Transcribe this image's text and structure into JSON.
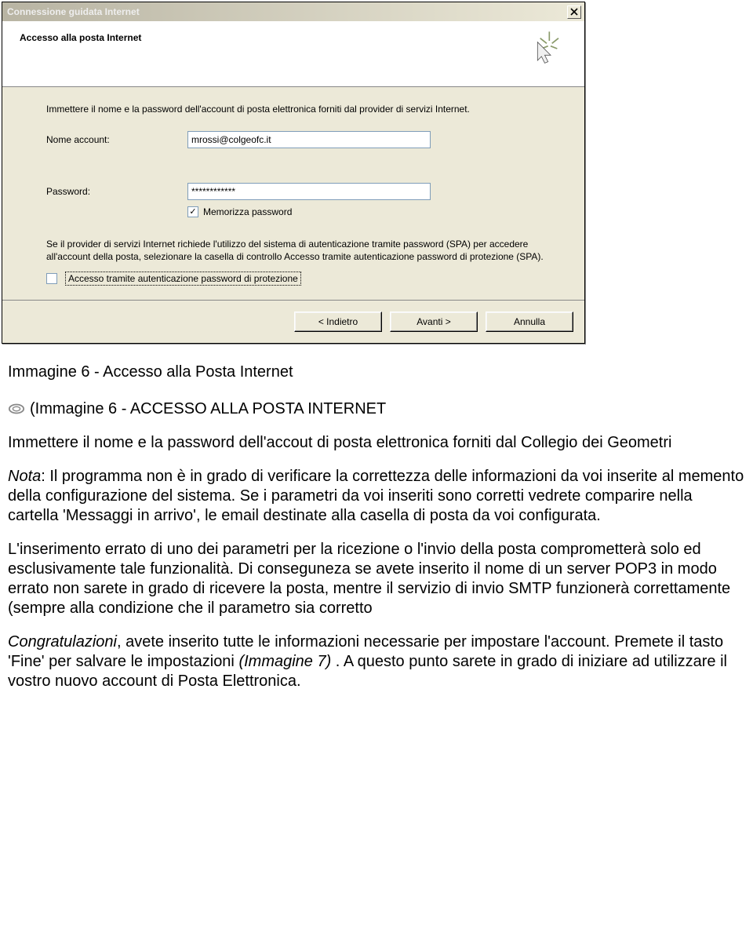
{
  "dialog": {
    "title": "Connessione guidata Internet",
    "close": "×",
    "header_title": "Accesso alla posta Internet",
    "intro": "Immettere il nome e la password dell'account di posta elettronica forniti dal provider di servizi Internet.",
    "account_label": "Nome account:",
    "account_value": "mrossi@colgeofc.it",
    "password_label": "Password:",
    "password_value": "************",
    "remember_label": "Memorizza password",
    "remember_checked": "✓",
    "spa_text": "Se il provider di servizi Internet richiede l'utilizzo del sistema di autenticazione tramite password (SPA) per accedere all'account della posta, selezionare la casella di controllo Accesso tramite autenticazione password di protezione (SPA).",
    "spa_check_label": "Accesso tramite autenticazione password di protezione",
    "btn_back": "< Indietro",
    "btn_next": "Avanti >",
    "btn_cancel": "Annulla"
  },
  "doc": {
    "caption": "Immagine 6 - Accesso alla Posta Internet",
    "line1": "(Immagine 6 - ACCESSO ALLA POSTA INTERNET",
    "para1a": "Immettere il nome e la password dell'accout di posta elettronica forniti dal Collegio dei Geometri",
    "para2_prefix": "Nota",
    "para2_rest": ": Il programma non è in grado di verificare la correttezza delle informazioni da voi inserite al memento della configurazione del sistema. Se i parametri da voi inseriti sono corretti vedrete comparire nella cartella 'Messaggi in arrivo', le email destinate alla casella di posta da voi configurata.",
    "para3": "L'inserimento errato di uno dei parametri per la ricezione o l'invio della posta comprometterà solo ed esclusivamente tale funzionalità. Di conseguneza se avete inserito il nome di un server POP3 in modo errato non sarete in grado di ricevere la posta, mentre il servizio di invio SMTP funzionerà correttamente (sempre alla condizione che il parametro sia corretto",
    "para4_prefix": "Congratulazioni",
    "para4_mid": ", avete inserito tutte le informazioni necessarie per impostare l'account. Premete il tasto 'Fine' per salvare le impostazioni ",
    "para4_ref": "(Immagine 7)",
    "para4_end": " . A questo punto sarete in grado di iniziare ad utilizzare il vostro nuovo account di Posta Elettronica."
  }
}
